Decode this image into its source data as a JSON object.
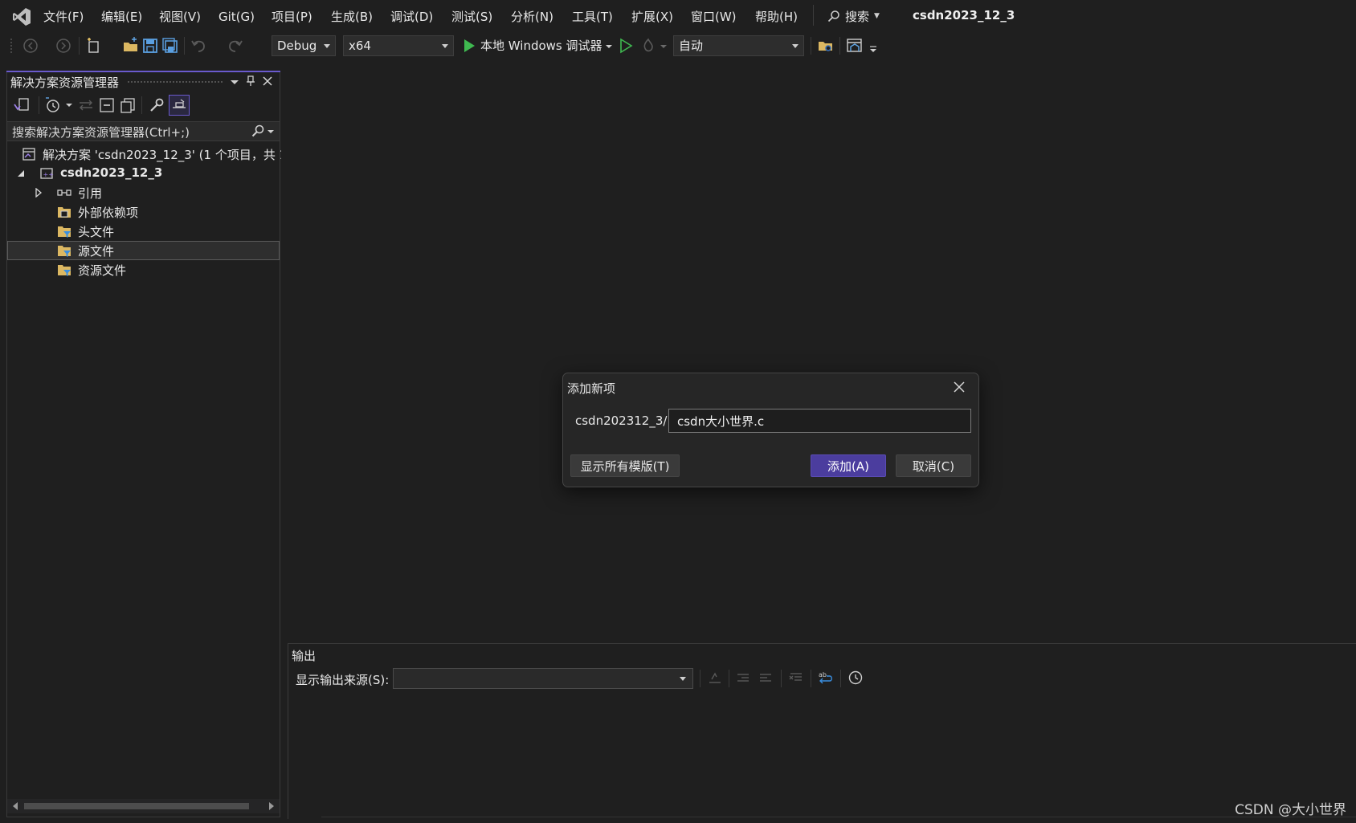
{
  "menu": {
    "items": [
      "文件(F)",
      "编辑(E)",
      "视图(V)",
      "Git(G)",
      "项目(P)",
      "生成(B)",
      "调试(D)",
      "测试(S)",
      "分析(N)",
      "工具(T)",
      "扩展(X)",
      "窗口(W)",
      "帮助(H)"
    ],
    "search_label": "搜索",
    "window_title": "csdn2023_12_3"
  },
  "toolbar": {
    "configuration": "Debug",
    "platform": "x64",
    "run_target": "本地 Windows 调试器",
    "mode": "自动"
  },
  "solution_explorer": {
    "title": "解决方案资源管理器",
    "search_placeholder": "搜索解决方案资源管理器(Ctrl+;)",
    "solution_label": "解决方案 'csdn2023_12_3' (1 个项目，共 1",
    "project_label": "csdn2023_12_3",
    "items": [
      "引用",
      "外部依赖项",
      "头文件",
      "源文件",
      "资源文件"
    ],
    "selected_item": "源文件"
  },
  "dialog": {
    "title": "添加新项",
    "path_prefix": "csdn202312_3/",
    "filename_value": "csdn大小世界.c",
    "show_all_templates": "显示所有模版(T)",
    "add_button": "添加(A)",
    "cancel_button": "取消(C)"
  },
  "output": {
    "title": "输出",
    "source_label": "显示输出来源(S):",
    "source_value": ""
  },
  "watermark": "CSDN @大小世界",
  "colors": {
    "background": "#1f1f1f",
    "accent_purple": "#4b3d9e",
    "run_green": "#3fb950"
  }
}
